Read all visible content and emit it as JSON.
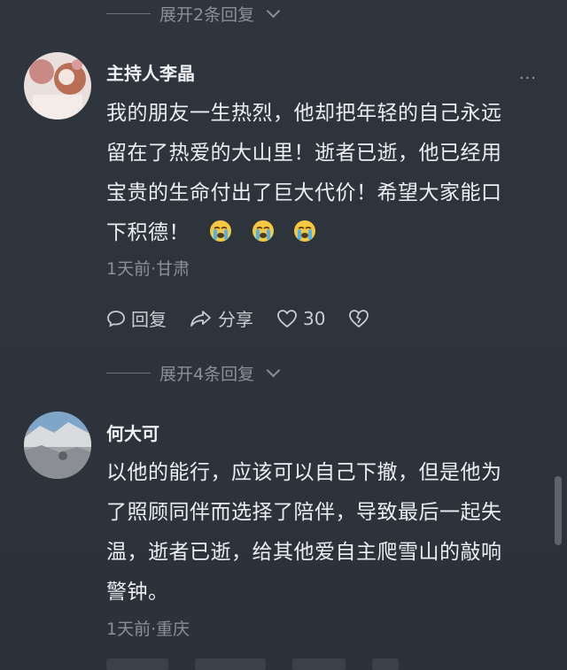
{
  "thread_top": {
    "expand_label": "展开2条回复"
  },
  "comment1": {
    "username": "主持人李晶",
    "more": "···",
    "lines": [
      "我的朋友一生热烈，他却把年轻的自己永远",
      "留在了热爱的大山里！逝者已逝，他已经用",
      "宝贵的生命付出了巨大代价！希望大家能口",
      "下积德！"
    ],
    "emoji": [
      "crying-face",
      "crying-face",
      "crying-face"
    ],
    "meta": "1天前·甘肃",
    "reply_label": "回复",
    "share_label": "分享",
    "like_count": "30",
    "expand_label": "展开4条回复"
  },
  "comment2": {
    "username": "何大可",
    "lines": [
      "以他的能行，应该可以自己下撤，但是他为",
      "了照顾同伴而选择了陪伴，导致最后一起失",
      "温，逝者已逝，给其他爱自主爬雪山的敲响",
      "警钟。"
    ],
    "meta": "1天前·重庆"
  },
  "colors": {
    "background": "#2f353e",
    "text_primary": "#eceef1",
    "text_secondary": "#8a9099",
    "emoji_yellow": "#f5c842"
  }
}
